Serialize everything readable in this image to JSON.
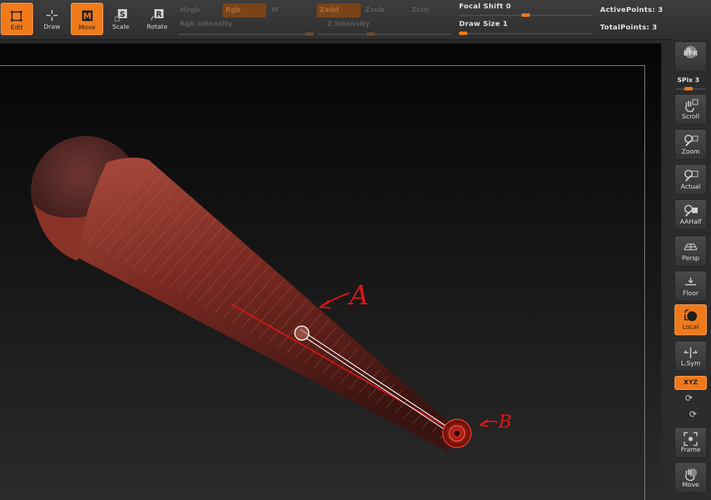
{
  "toolbar": {
    "tools": [
      {
        "label": "Edit",
        "icon": "edit-icon",
        "active": true
      },
      {
        "label": "Draw",
        "icon": "draw-icon",
        "active": false
      },
      {
        "label": "Move",
        "icon": "move-icon",
        "active": true
      },
      {
        "label": "Scale",
        "icon": "scale-icon",
        "active": false
      },
      {
        "label": "Rotate",
        "icon": "rotate-icon",
        "active": false
      }
    ],
    "mrgb_label": "Mrgb",
    "rgb_label": "Rgb",
    "m_label": "M",
    "rgb_intensity_label": "Rgb Intensity",
    "zadd_label": "Zadd",
    "zsub_label": "Zsub",
    "zcut_label": "Zcut",
    "z_intensity_label": "Z Intensity",
    "focal_shift_label": "Focal Shift 0",
    "focal_shift_value": 0,
    "draw_size_label": "Draw Size 1",
    "draw_size_value": 1,
    "active_points_label": "ActivePoints: 3",
    "total_points_label": "TotalPoints: 3"
  },
  "canvas": {
    "annotation_a": "A",
    "annotation_b": "B",
    "model_color": "#7a2a22",
    "annotation_color": "#e01515"
  },
  "shelf": {
    "bpr_label": "BPR",
    "spix_label": "SPix 3",
    "buttons": [
      {
        "label": "Scroll",
        "icon": "scroll-hand-icon",
        "active": false
      },
      {
        "label": "Zoom",
        "icon": "zoom-icon",
        "active": false
      },
      {
        "label": "Actual",
        "icon": "actual-icon",
        "active": false
      },
      {
        "label": "AAHalf",
        "icon": "aahalf-icon",
        "active": false
      },
      {
        "label": "Persp",
        "icon": "perspective-grid-icon",
        "active": false
      },
      {
        "label": "Floor",
        "icon": "floor-icon",
        "active": false
      },
      {
        "label": "Local",
        "icon": "local-icon",
        "active": true
      },
      {
        "label": "L.Sym",
        "icon": "local-symmetry-icon",
        "active": false
      }
    ],
    "xyz_label": "XYZ",
    "frame_label": "Frame",
    "move_label": "Move"
  },
  "colors": {
    "accent": "#f07a1a",
    "panel": "#2c2c2c"
  }
}
